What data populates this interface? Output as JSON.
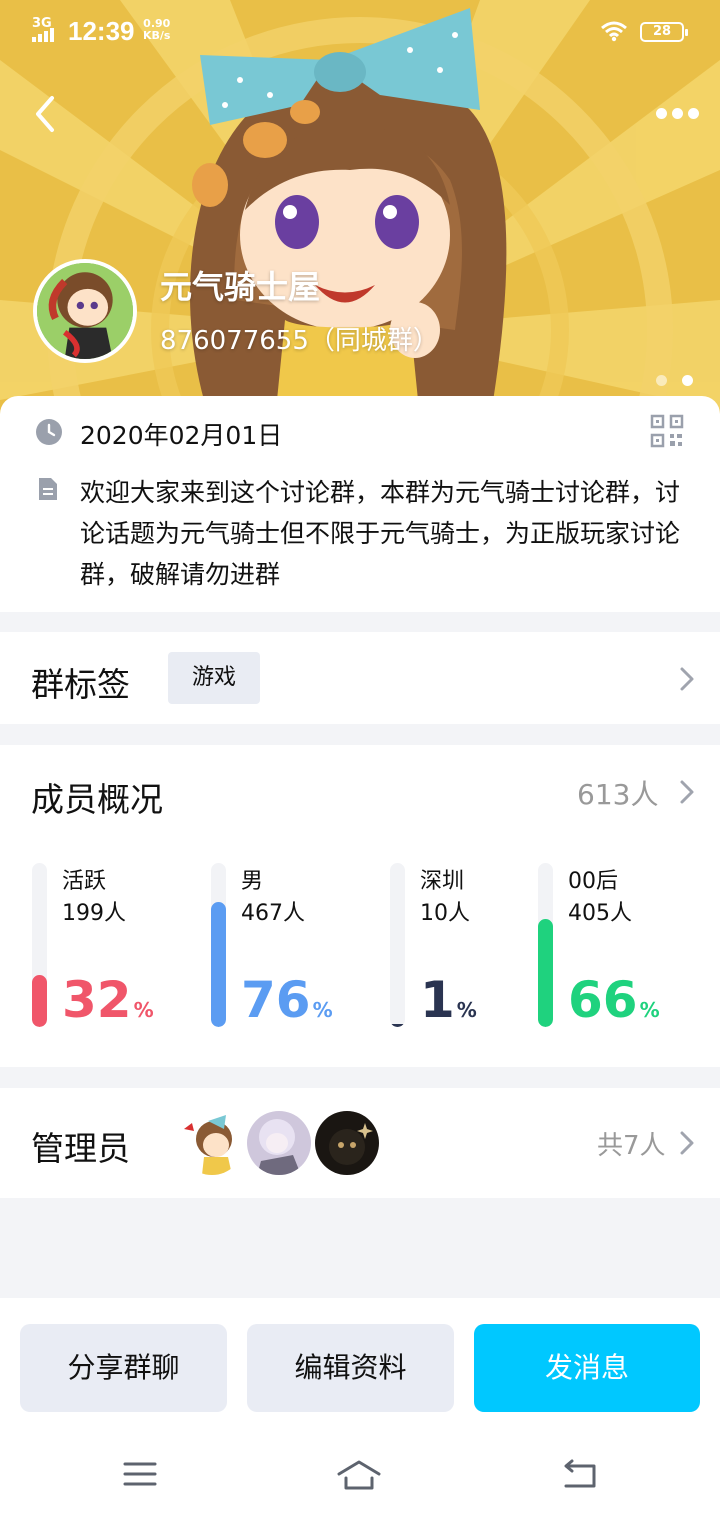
{
  "status_bar": {
    "network": "3G",
    "time": "12:39",
    "speed_value": "0.90",
    "speed_unit": "KB/s",
    "battery": "28"
  },
  "group": {
    "name": "元气骑士屋",
    "id_line": "876077655（同城群）",
    "date": "2020年02月01日",
    "intro": "欢迎大家来到这个讨论群，本群为元气骑士讨论群，讨论话题为元气骑士但不限于元气骑士，为正版玩家讨论群，破解请勿进群"
  },
  "tags": {
    "title": "群标签",
    "items": [
      "游戏"
    ]
  },
  "members": {
    "title": "成员概况",
    "count": "613人",
    "stats": [
      {
        "label": "活跃",
        "count": "199人",
        "percent": "32",
        "fraction": 0.32,
        "color": "#f0566a"
      },
      {
        "label": "男",
        "count": "467人",
        "percent": "76",
        "fraction": 0.76,
        "color": "#5b9cf2"
      },
      {
        "label": "深圳",
        "count": "10人",
        "percent": "1",
        "fraction": 0.01,
        "color": "#2a3451"
      },
      {
        "label": "00后",
        "count": "405人",
        "percent": "66",
        "fraction": 0.66,
        "color": "#1fd27e"
      }
    ],
    "percent_unit": "%"
  },
  "admins": {
    "title": "管理员",
    "total": "共7人"
  },
  "actions": {
    "share": "分享群聊",
    "edit": "编辑资料",
    "send": "发消息"
  },
  "colors": {
    "accent": "#00c8ff",
    "banner": "#e8bd45"
  }
}
